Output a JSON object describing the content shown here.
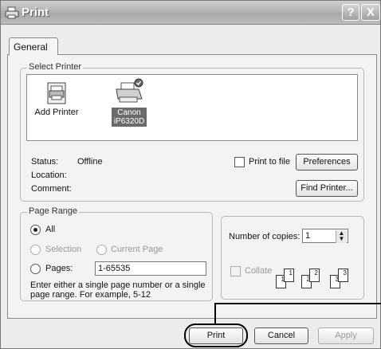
{
  "window": {
    "title": "Print"
  },
  "titlebar": {
    "help_label": "?",
    "close_label": "X"
  },
  "tabs": [
    {
      "label": "General"
    }
  ],
  "select_printer": {
    "legend": "Select Printer",
    "printers": [
      {
        "name": "Add Printer",
        "icon": "add-printer-icon",
        "selected": false
      },
      {
        "name_line1": "Canon",
        "name_line2": "iP6320D",
        "icon": "printer-icon",
        "selected": true
      }
    ],
    "status_label": "Status:",
    "status_value": "Offline",
    "location_label": "Location:",
    "comment_label": "Comment:",
    "print_to_file_label": "Print to file",
    "preferences_label": "Preferences",
    "find_printer_label": "Find Printer..."
  },
  "page_range": {
    "legend": "Page Range",
    "all_label": "All",
    "selection_label": "Selection",
    "current_page_label": "Current Page",
    "pages_label": "Pages:",
    "pages_value": "1-65535",
    "hint_line1": "Enter either a single page number or a single",
    "hint_line2": "page range.  For example, 5-12"
  },
  "copies": {
    "number_label": "Number of copies:",
    "number_value": "1",
    "collate_label": "Collate",
    "collate_pages": [
      "1",
      "1",
      "2",
      "2",
      "3",
      "3"
    ]
  },
  "footer": {
    "print_label": "Print",
    "cancel_label": "Cancel",
    "apply_label": "Apply"
  }
}
